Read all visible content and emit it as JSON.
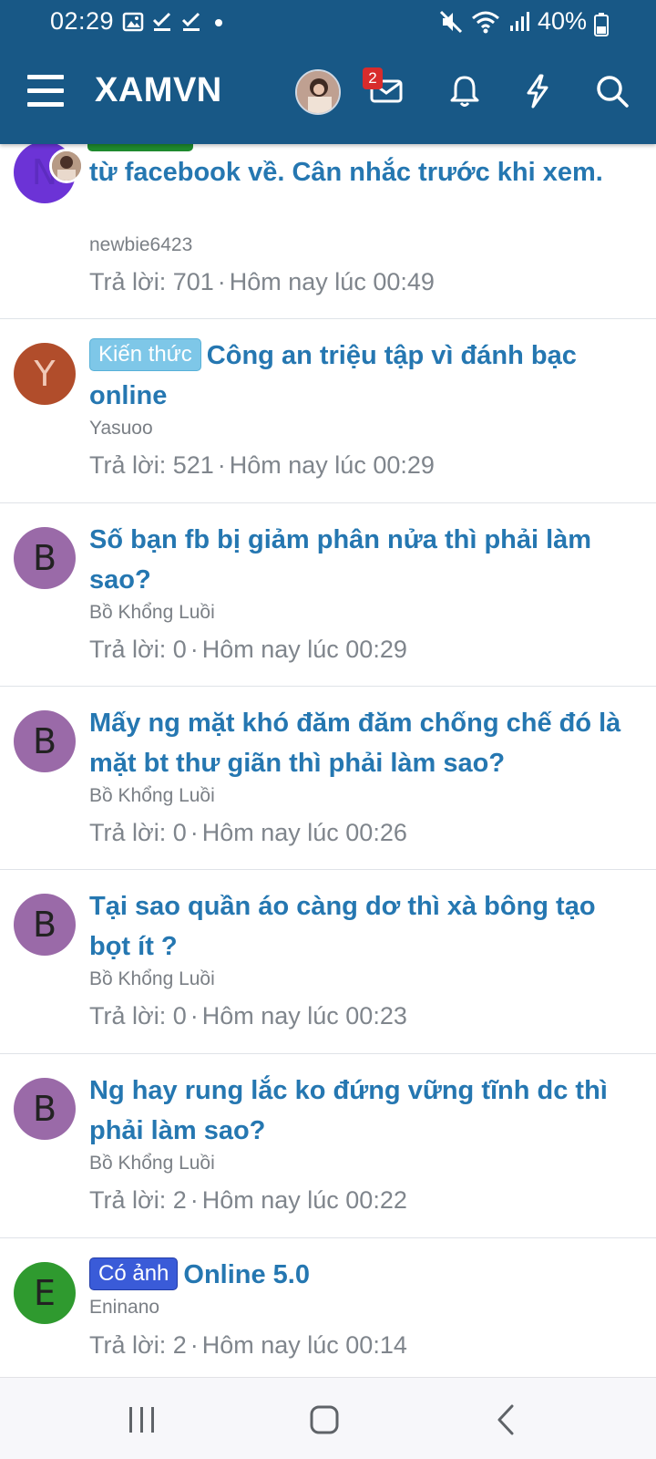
{
  "status_bar": {
    "time": "02:29",
    "battery": "40%",
    "left_icons": [
      "image-icon",
      "check-icon",
      "check-icon",
      "dot-icon"
    ],
    "right_icons": [
      "mute-icon",
      "wifi-icon",
      "signal-icon",
      "battery-icon"
    ]
  },
  "header": {
    "title": "XAMVN",
    "message_badge": "2",
    "bg_color": "#185886"
  },
  "threads": [
    {
      "title_lines": "từ facebook về. Cân nhắc trước khi xem.",
      "author": "newbie6423",
      "replies_label": "Trả lời: 701",
      "time": "Hôm nay lúc 00:49",
      "avatar_letter": "N",
      "avatar_color": "#6c33d6"
    },
    {
      "prefix": "Kiến thức",
      "title": "Công an triệu tập vì đánh bạc online",
      "author": "Yasuoo",
      "replies_label": "Trả lời: 521",
      "time": "Hôm nay lúc 00:29",
      "avatar_letter": "Y",
      "avatar_color": "#b14d2b"
    },
    {
      "title": "Số bạn fb bị giảm phân nửa thì phải làm sao?",
      "author": "Bồ Khổng Luồi",
      "replies_label": "Trả lời: 0",
      "time": "Hôm nay lúc 00:29",
      "avatar_letter": "B",
      "avatar_color": "#9a6aa8"
    },
    {
      "title": "Mấy ng mặt khó đăm đăm chống chế đó là mặt bt thư giãn thì phải làm sao?",
      "author": "Bồ Khổng Luồi",
      "replies_label": "Trả lời: 0",
      "time": "Hôm nay lúc 00:26",
      "avatar_letter": "B",
      "avatar_color": "#9a6aa8"
    },
    {
      "title": "Tại sao quần áo càng dơ thì xà bông tạo bọt ít ?",
      "author": "Bồ Khổng Luồi",
      "replies_label": "Trả lời: 0",
      "time": "Hôm nay lúc 00:23",
      "avatar_letter": "B",
      "avatar_color": "#9a6aa8"
    },
    {
      "title": "Ng hay rung lắc ko đứng vững tĩnh dc thì phải làm sao?",
      "author": "Bồ Khổng Luồi",
      "replies_label": "Trả lời: 2",
      "time": "Hôm nay lúc 00:22",
      "avatar_letter": "B",
      "avatar_color": "#9a6aa8"
    },
    {
      "prefix": "Có ảnh",
      "title": "Online 5.0",
      "author": "Eninano",
      "replies_label": "Trả lời: 2",
      "time": "Hôm nay lúc 00:14",
      "avatar_letter": "E",
      "avatar_color": "#2f9a2f"
    }
  ],
  "separator": "·",
  "navbar": {
    "buttons": [
      "recent-apps-icon",
      "home-icon",
      "back-icon"
    ]
  }
}
